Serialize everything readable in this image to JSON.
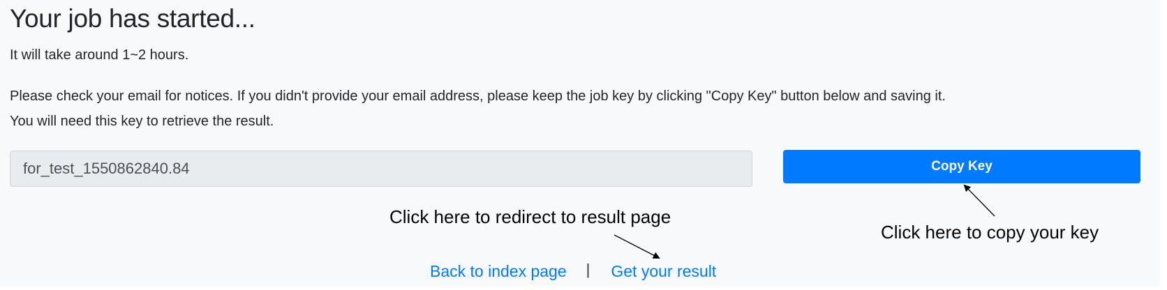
{
  "page": {
    "title": "Your job has started...",
    "duration_text": "It will take around 1~2 hours.",
    "notice_line1": "Please check your email for notices. If you didn't provide your email address, please keep the job key by clicking \"Copy Key\" button below and saving it.",
    "notice_line2": "You will need this key to retrieve the result."
  },
  "key_field": {
    "value": "for_test_1550862840.84"
  },
  "copy_button": {
    "label": "Copy Key",
    "color": "#007bff"
  },
  "annotations": {
    "redirect": "Click here to redirect to result page",
    "copy": "Click here to copy your key"
  },
  "links": {
    "back": "Back to index page",
    "separator": "|",
    "result": "Get your result",
    "color": "#007bff"
  }
}
